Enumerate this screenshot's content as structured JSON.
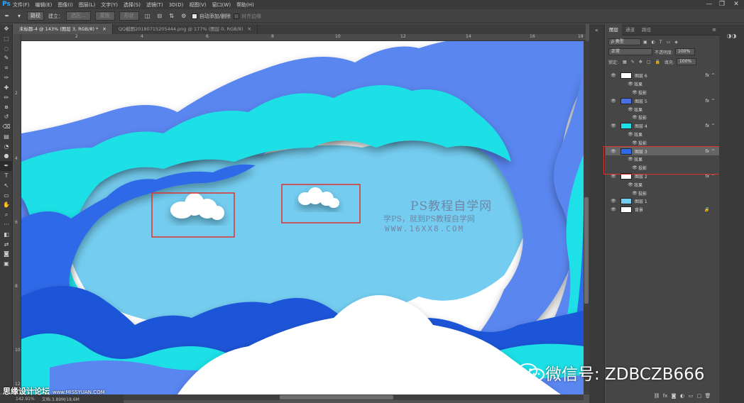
{
  "app": {
    "logo": "Ps",
    "menu": [
      "文件(F)",
      "编辑(E)",
      "图像(I)",
      "图层(L)",
      "文字(Y)",
      "选择(S)",
      "滤镜(T)",
      "3D(D)",
      "视图(V)",
      "窗口(W)",
      "帮助(H)"
    ],
    "window_controls": [
      "—",
      "❐",
      "✕"
    ]
  },
  "options_bar": {
    "mode": "路径",
    "make_label": "建立：",
    "selection_btn": "选区...",
    "mask_btn": "蒙版",
    "shape_btn": "形状",
    "auto_add_delete": "自动添加/删除",
    "align_edges": "对齐边缘"
  },
  "tools": [
    "move-icon",
    "marquee-icon",
    "lasso-icon",
    "quick-select-icon",
    "crop-icon",
    "eyedropper-icon",
    "healing-icon",
    "brush-icon",
    "stamp-icon",
    "history-brush-icon",
    "eraser-icon",
    "gradient-icon",
    "blur-icon",
    "dodge-icon",
    "pen-icon",
    "type-icon",
    "path-select-icon",
    "rectangle-icon",
    "hand-icon",
    "zoom-icon",
    "more-icon",
    "color-swatch-icon",
    "swap-icon",
    "quickmask-icon",
    "screen-mode-icon"
  ],
  "tools_glyphs": [
    "✥",
    "⬚",
    "◌",
    "✎",
    "⌗",
    "✑",
    "✚",
    "✏",
    "⧇",
    "↺",
    "⌫",
    "▤",
    "◔",
    "●",
    "✒",
    "T",
    "↖",
    "▭",
    "✋",
    "⌕",
    "···",
    "◧",
    "⇄",
    "◙",
    "▣"
  ],
  "doc_tabs": [
    {
      "label": "未标题-4 @ 143% (图层 3, RGB/8) *",
      "close": "✕"
    },
    {
      "label": "QQ截图20180715205444.png @ 177% (图层 0, RGB/8)",
      "close": "✕"
    }
  ],
  "ruler": {
    "top": [
      "2",
      "4",
      "6",
      "8",
      "10",
      "12",
      "14",
      "16",
      "18"
    ],
    "left": [
      "2",
      "4",
      "6",
      "8",
      "10",
      "12"
    ]
  },
  "status": {
    "zoom": "142.91%",
    "doc": "文档:3.89M/18.6M"
  },
  "panel": {
    "tabs": [
      "图层",
      "通道",
      "路径"
    ],
    "filter_kind": "ρ 类型",
    "blend_mode": "正常",
    "opacity_label": "不透明度:",
    "opacity_value": "100%",
    "lock_label": "锁定:",
    "fill_label": "填充:",
    "fill_value": "100%",
    "layers": [
      {
        "name": "图层 6",
        "fx": "fx",
        "effects_label": "效果",
        "effect": "投影",
        "thumb_color": "#ffffff"
      },
      {
        "name": "图层 5",
        "fx": "fx",
        "effects_label": "效果",
        "effect": "投影",
        "thumb_color": "#4a6fe0"
      },
      {
        "name": "图层 4",
        "fx": "fx",
        "effects_label": "效果",
        "effect": "投影",
        "thumb_color": "#1ee0e6"
      },
      {
        "name": "图层 3",
        "fx": "fx",
        "effects_label": "效果",
        "effect": "投影",
        "thumb_color": "#2f6be8",
        "selected": true
      },
      {
        "name": "图层 2",
        "fx": "fx",
        "effects_label": "效果",
        "effect": "投影",
        "thumb_color": "#ffffff"
      },
      {
        "name": "图层 1",
        "thumb_color": "#74cdf0"
      },
      {
        "name": "背景",
        "lock": "🔒",
        "thumb_color": "#ffffff"
      }
    ],
    "bottom_icons": [
      "link-icon",
      "fx-icon",
      "mask-icon",
      "adjustment-icon",
      "group-icon",
      "new-layer-icon",
      "trash-icon"
    ],
    "bottom_glyphs": [
      "⛓",
      "fx",
      "◙",
      "◐",
      "▭",
      "▢",
      "🗑"
    ]
  },
  "watermarks": {
    "ps_title": "PS教程自学网",
    "ps_sub": "学PS，就到PS教程自学网",
    "ps_url": "WWW.16XX8.COM",
    "site": "思缘设计论坛",
    "site_url": "www.MISSYUAN.COM",
    "wechat": "微信号: ZDBCZB666"
  },
  "colors": {
    "accent": "#31a8ff",
    "highlight": "#e0302c",
    "sky": "#74cdf0",
    "cyan": "#1ee0e6",
    "blue": "#2f6be8",
    "deepblue": "#1f55d8",
    "periwinkle": "#5a86f0"
  }
}
